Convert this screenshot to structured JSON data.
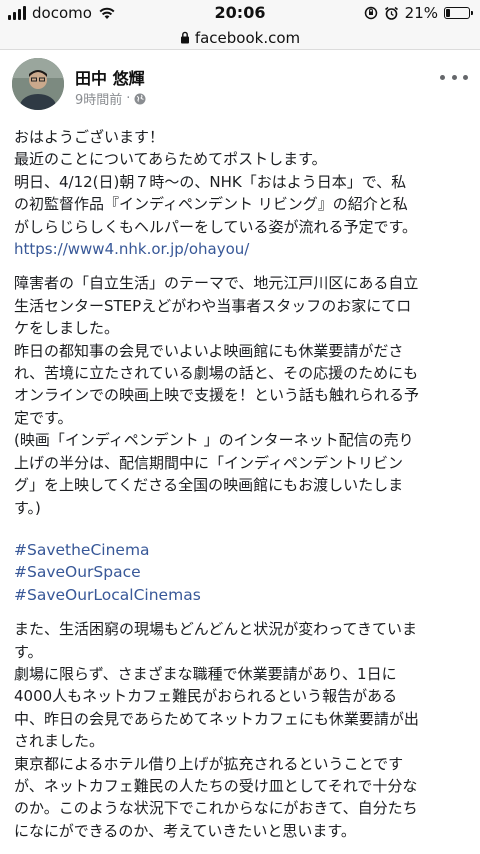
{
  "status_bar": {
    "carrier": "docomo",
    "time": "20:06",
    "battery_percent": "21%",
    "battery_level": 0.21
  },
  "url_bar": {
    "domain": "facebook.com"
  },
  "post": {
    "author": "田中 悠輝",
    "time_ago": "9時間前",
    "separator": "·",
    "paragraphs": [
      {
        "lines": [
          "おはようございます！",
          "最近のことについてあらためてポストします。",
          "明日、4/12(日)朝７時〜の、NHK「おはよう日本」で、私",
          "の初監督作品『インディペンデント リビング』の紹介と私",
          "がしらじらしくもヘルパーをしている姿が流れる予定です。"
        ],
        "link": "https://www4.nhk.or.jp/ohayou/"
      },
      {
        "lines": [
          "障害者の「自立生活」のテーマで、地元江戸川区にある自立",
          "生活センターSTEPえどがわや当事者スタッフのお家にてロ",
          "ケをしました。",
          "昨日の都知事の会見でいよいよ映画館にも休業要請がださ",
          "れ、苦境に立たされている劇場の話と、その応援のためにも",
          "オンラインでの映画上映で支援を！という話も触れられる予",
          "定です。",
          "(映画「インディペンデント 」のインターネット配信の売り",
          "上げの半分は、配信期間中に「インディペンデントリビン",
          "グ」を上映してくださる全国の映画館にもお渡しいたしま",
          "す。)"
        ]
      },
      {
        "hashtags": [
          "#SavetheCinema",
          "#SaveOurSpace",
          "#SaveOurLocalCinemas"
        ]
      },
      {
        "lines": [
          "また、生活困窮の現場もどんどんと状況が変わってきていま",
          "す。",
          "劇場に限らず、さまざまな職種で休業要請があり、1日に",
          "4000人もネットカフェ難民がおられるという報告がある",
          "中、昨日の会見であらためてネットカフェにも休業要請が出",
          "されました。",
          "東京都によるホテル借り上げが拡充されるということです",
          "が、ネットカフェ難民の人たちの受け皿としてそれで十分な",
          "のか。このような状況下でこれからなにがおきて、自分たち",
          "になにができるのか、考えていきたいと思います。"
        ]
      }
    ]
  }
}
